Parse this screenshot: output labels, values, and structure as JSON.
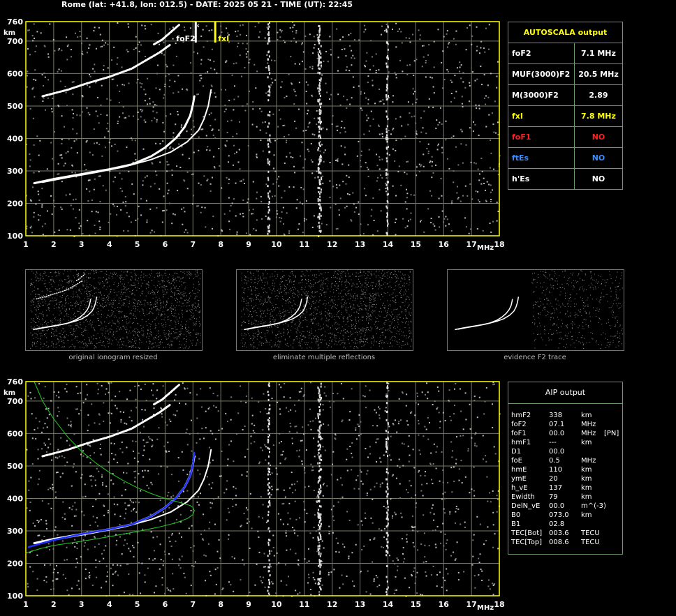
{
  "header": {
    "title": "Rome (lat: +41.8, lon: 012.5) - DATE: 2025 05 21 - TIME (UT): 22:45"
  },
  "colors": {
    "grid": "#7a7a6a",
    "frame": "#ffff00",
    "trace": "#ffffff",
    "aip_profile": "#1f2fff",
    "model_curve": "#22cc22",
    "fof1": "#ff2020",
    "ftes": "#3a8cff",
    "fxi": "#ffff00"
  },
  "chart_data": [
    {
      "type": "scatter",
      "panel": "top-ionogram",
      "xlabel": "MHz",
      "ylabel": "km",
      "xlim": [
        1,
        18
      ],
      "ylim": [
        100,
        760
      ],
      "x_ticks": [
        1,
        2,
        3,
        4,
        5,
        6,
        7,
        8,
        9,
        10,
        11,
        12,
        13,
        14,
        15,
        16,
        17,
        18
      ],
      "y_ticks": [
        100,
        200,
        300,
        400,
        500,
        600,
        700,
        760
      ],
      "grid": true,
      "annotations": [
        {
          "label": "foF2",
          "x": 7.1
        },
        {
          "label": "fxI",
          "x": 7.8
        }
      ],
      "series": [
        {
          "label": "o-trace",
          "x": [
            1.3,
            2.0,
            3.0,
            4.0,
            4.8,
            5.5,
            6.0,
            6.4,
            6.7,
            6.9,
            7.0,
            7.05
          ],
          "y": [
            262,
            275,
            290,
            305,
            320,
            345,
            372,
            402,
            435,
            470,
            505,
            530
          ]
        },
        {
          "label": "x-trace",
          "x": [
            1.6,
            2.5,
            3.5,
            4.5,
            5.5,
            6.2,
            6.8,
            7.2,
            7.4,
            7.55,
            7.65
          ],
          "y": [
            265,
            280,
            295,
            312,
            335,
            358,
            390,
            425,
            460,
            500,
            550
          ]
        },
        {
          "label": "multiple-reflection",
          "x": [
            1.6,
            2.5,
            3.2,
            4.0,
            4.8,
            5.3,
            5.8,
            6.2
          ],
          "y": [
            530,
            550,
            570,
            590,
            615,
            640,
            665,
            690
          ]
        },
        {
          "label": "multiple-reflection-x",
          "x": [
            5.6,
            5.9,
            6.1,
            6.3,
            6.5
          ],
          "y": [
            690,
            705,
            720,
            735,
            750
          ]
        }
      ]
    },
    {
      "type": "scatter",
      "panel": "bottom-ionogram",
      "xlabel": "MHz",
      "ylabel": "km",
      "xlim": [
        1,
        18
      ],
      "ylim": [
        100,
        760
      ],
      "x_ticks": [
        1,
        2,
        3,
        4,
        5,
        6,
        7,
        8,
        9,
        10,
        11,
        12,
        13,
        14,
        15,
        16,
        17,
        18
      ],
      "y_ticks": [
        100,
        200,
        300,
        400,
        500,
        600,
        700,
        760
      ],
      "grid": true,
      "series": [
        {
          "label": "o-trace",
          "x": [
            1.3,
            2.0,
            3.0,
            4.0,
            4.8,
            5.5,
            6.0,
            6.4,
            6.7,
            6.9,
            7.0,
            7.05
          ],
          "y": [
            262,
            275,
            290,
            305,
            320,
            345,
            372,
            402,
            435,
            470,
            505,
            530
          ]
        },
        {
          "label": "x-trace",
          "x": [
            1.6,
            2.5,
            3.5,
            4.5,
            5.5,
            6.2,
            6.8,
            7.2,
            7.4,
            7.55,
            7.65
          ],
          "y": [
            265,
            280,
            295,
            312,
            335,
            358,
            390,
            425,
            460,
            500,
            550
          ]
        },
        {
          "label": "multiple-reflection",
          "x": [
            1.6,
            2.5,
            3.2,
            4.0,
            4.8,
            5.3,
            5.8,
            6.2
          ],
          "y": [
            530,
            550,
            570,
            590,
            615,
            640,
            665,
            690
          ]
        },
        {
          "label": "multiple-reflection-x",
          "x": [
            5.6,
            5.9,
            6.1,
            6.3,
            6.5
          ],
          "y": [
            690,
            705,
            720,
            735,
            750
          ]
        },
        {
          "label": "aip-profile",
          "x": [
            1.1,
            1.5,
            2.0,
            3.0,
            4.0,
            4.8,
            5.5,
            6.0,
            6.4,
            6.7,
            6.9,
            7.0,
            7.05
          ],
          "y": [
            250,
            260,
            272,
            290,
            305,
            320,
            345,
            372,
            402,
            435,
            470,
            505,
            540
          ]
        },
        {
          "label": "model-lower",
          "x": [
            1.0,
            1.5,
            2.0,
            3.0,
            4.0,
            5.0,
            5.8,
            6.4,
            6.8,
            7.0,
            7.05,
            7.0,
            6.9
          ],
          "y": [
            232,
            245,
            255,
            268,
            282,
            298,
            312,
            325,
            338,
            350,
            362,
            372,
            378
          ]
        },
        {
          "label": "model-upper",
          "x": [
            1.3,
            1.6,
            2.0,
            2.5,
            3.0,
            3.5,
            4.0,
            4.5,
            5.0,
            5.5,
            6.0,
            6.5,
            6.9
          ],
          "y": [
            760,
            700,
            645,
            590,
            545,
            510,
            480,
            455,
            433,
            415,
            400,
            388,
            378
          ]
        }
      ]
    }
  ],
  "mini_panels": [
    {
      "caption": "original ionogram resized"
    },
    {
      "caption": "eliminate multiple reflections"
    },
    {
      "caption": "evidence F2 trace"
    }
  ],
  "autoscala": {
    "title": "AUTOSCALA output",
    "rows": [
      {
        "name": "foF2",
        "value": "7.1 MHz",
        "color": "#ffffff"
      },
      {
        "name": "MUF(3000)F2",
        "value": "20.5 MHz",
        "color": "#ffffff"
      },
      {
        "name": "M(3000)F2",
        "value": "2.89",
        "color": "#ffffff"
      },
      {
        "name": "fxI",
        "value": "7.8 MHz",
        "color": "#ffff00"
      },
      {
        "name": "foF1",
        "value": "NO",
        "color": "#ff2020"
      },
      {
        "name": "ftEs",
        "value": "NO",
        "color": "#3a8cff"
      },
      {
        "name": "h'Es",
        "value": "NO",
        "color": "#ffffff"
      }
    ]
  },
  "aip": {
    "title": "AIP output",
    "rows": [
      {
        "name": "hmF2",
        "value": "338",
        "unit": "km",
        "extra": ""
      },
      {
        "name": "foF2",
        "value": "07.1",
        "unit": "MHz",
        "extra": ""
      },
      {
        "name": "foF1",
        "value": "00.0",
        "unit": "MHz",
        "extra": "[PN]"
      },
      {
        "name": "hmF1",
        "value": "---",
        "unit": "km",
        "extra": ""
      },
      {
        "name": "D1",
        "value": "00.0",
        "unit": "",
        "extra": ""
      },
      {
        "name": "foE",
        "value": "0.5",
        "unit": "MHz",
        "extra": ""
      },
      {
        "name": "hmE",
        "value": "110",
        "unit": "km",
        "extra": ""
      },
      {
        "name": "ymE",
        "value": "20",
        "unit": "km",
        "extra": ""
      },
      {
        "name": "h_vE",
        "value": "137",
        "unit": "km",
        "extra": ""
      },
      {
        "name": "Ewidth",
        "value": "79",
        "unit": "km",
        "extra": ""
      },
      {
        "name": "DelN_vE",
        "value": "00.0",
        "unit": "m^(-3)",
        "extra": ""
      },
      {
        "name": "B0",
        "value": "073.0",
        "unit": "km",
        "extra": ""
      },
      {
        "name": "B1",
        "value": "02.8",
        "unit": "",
        "extra": ""
      },
      {
        "name": "TEC[Bot]",
        "value": "003.6",
        "unit": "TECU",
        "extra": ""
      },
      {
        "name": "TEC[Top]",
        "value": "008.6",
        "unit": "TECU",
        "extra": ""
      }
    ]
  }
}
